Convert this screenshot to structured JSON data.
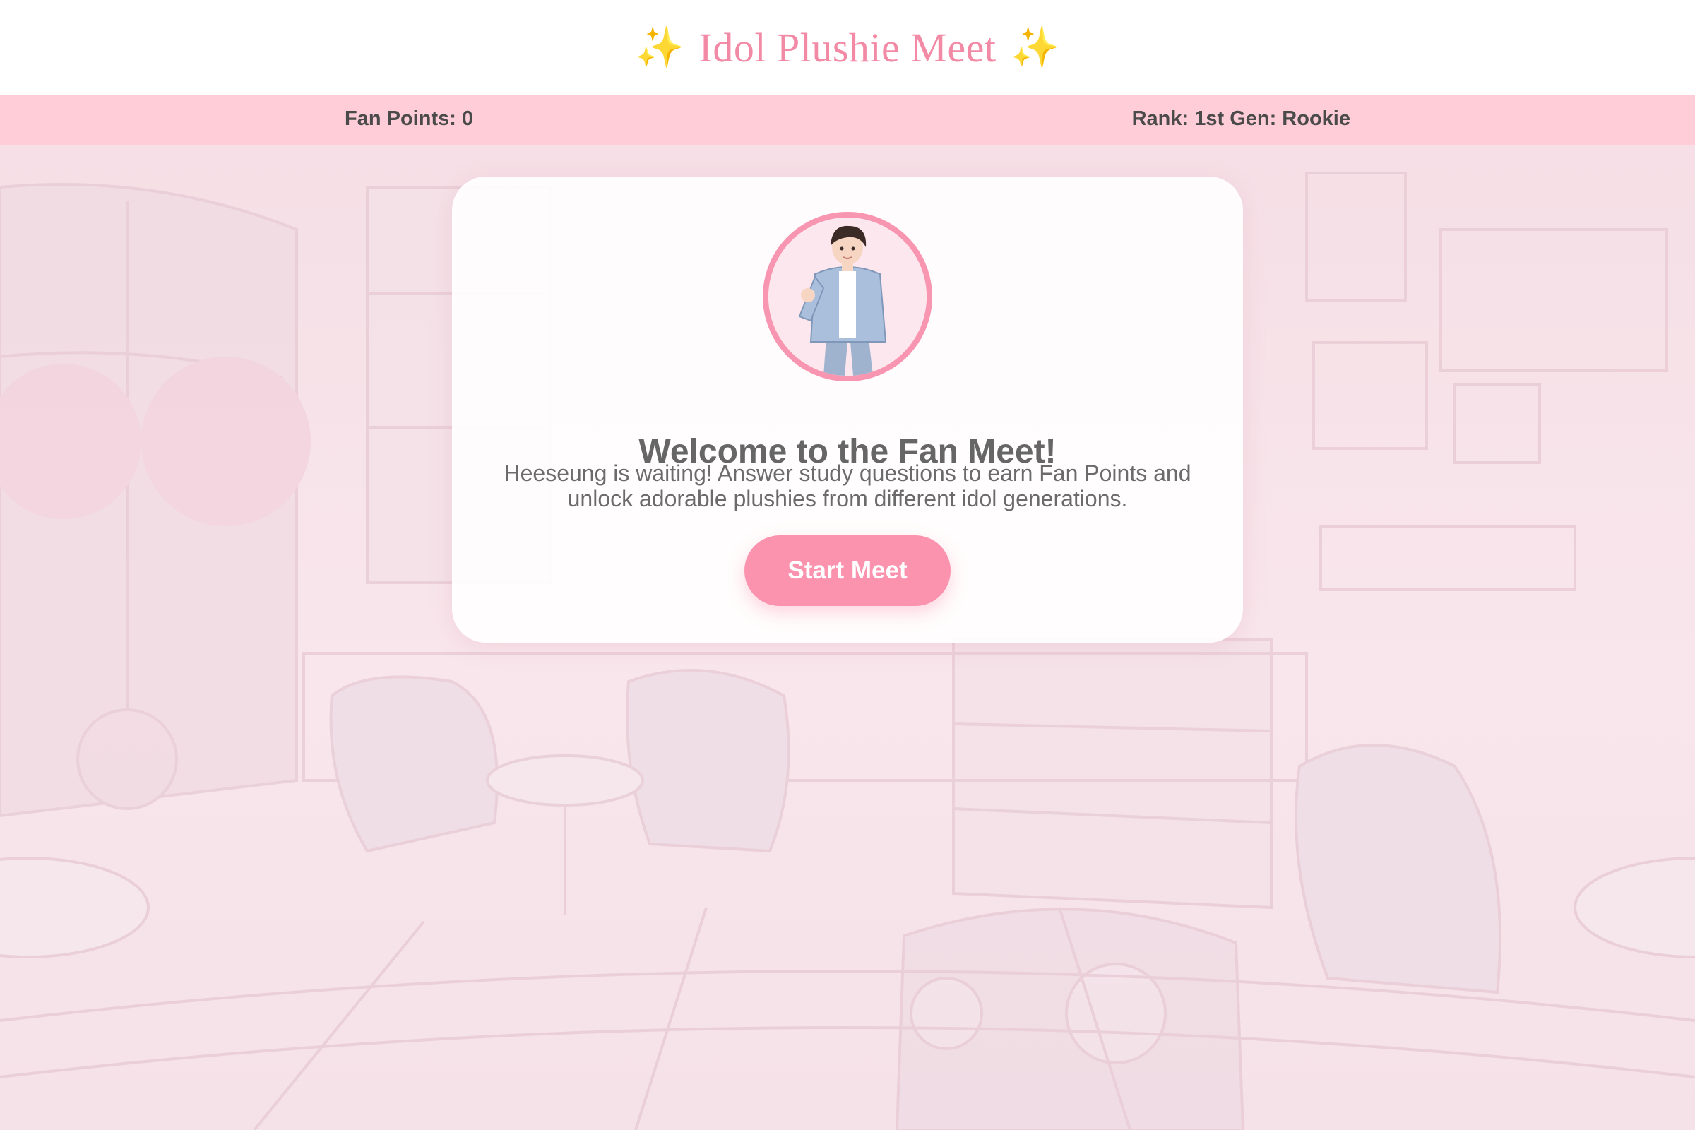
{
  "header": {
    "title": "Idol Plushie Meet",
    "left_icon": "sparkles-icon",
    "right_icon": "sparkles-icon",
    "sparkle_glyph": "✨"
  },
  "status": {
    "fan_points": "Fan Points: 0",
    "rank": "Rank: 1st Gen: Rookie"
  },
  "card": {
    "avatar_icon": "idol-avatar",
    "heading": "Welcome to the Fan Meet!",
    "description": "Heeseung is waiting! Answer study questions to earn Fan Points and unlock adorable plushies from different idol generations.",
    "button_label": "Start Meet"
  },
  "colors": {
    "accent": "#fb92ae",
    "title": "#f28aa6",
    "status_bar": "#ffcdd8",
    "background": "#f8e6ec"
  }
}
